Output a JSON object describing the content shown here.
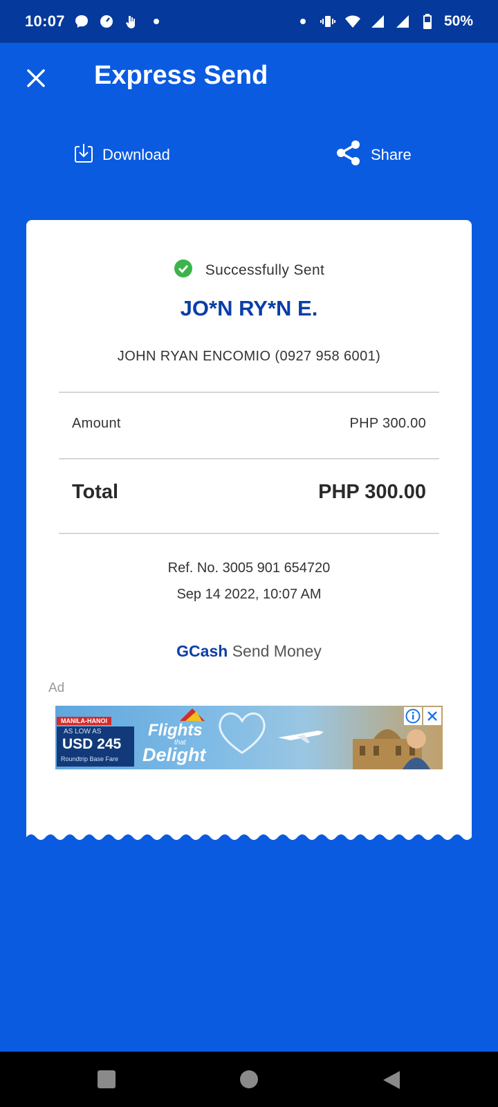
{
  "status_bar": {
    "time": "10:07",
    "battery": "50%",
    "left_icons": [
      "messenger-icon",
      "speedometer-icon",
      "hand-icon",
      "dot-icon"
    ],
    "right_icons": [
      "dot-icon",
      "vibrate-icon",
      "wifi-icon",
      "signal-icon",
      "signal-icon",
      "battery-icon"
    ]
  },
  "header": {
    "title": "Express Send"
  },
  "actions": {
    "download_label": "Download",
    "share_label": "Share"
  },
  "receipt": {
    "status": "Successfully Sent",
    "recipient_masked": "JO*N RY*N E.",
    "recipient_full": "JOHN RYAN ENCOMIO (0927 958 6001)",
    "amount_label": "Amount",
    "amount_value": "PHP 300.00",
    "total_label": "Total",
    "total_value": "PHP 300.00",
    "reference": "Ref. No. 3005 901 654720",
    "datetime": "Sep 14 2022, 10:07 AM",
    "brand": "GCash",
    "brand_service": "Send Money",
    "ad_label": "Ad"
  },
  "ad_banner": {
    "route": "MANILA-HANOI",
    "as_low_as": "AS LOW AS",
    "price": "USD 245",
    "fare_type": "Roundtrip Base Fare",
    "headline_1": "Flights",
    "headline_2": "that",
    "headline_3": "Delight"
  },
  "colors": {
    "background": "#0a5be0",
    "status_bar": "#053a9c",
    "brand_blue": "#0a3ea8",
    "success_green": "#3cb44b"
  }
}
